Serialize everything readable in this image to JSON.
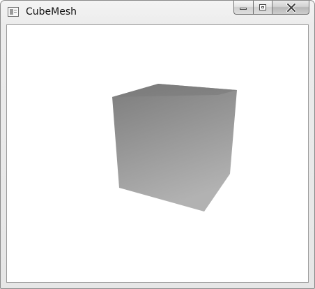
{
  "window": {
    "title": "CubeMesh",
    "icons": {
      "app": "window-app-icon",
      "minimize": "minimize-icon",
      "maximize": "maximize-icon",
      "close": "close-icon"
    }
  },
  "viewport": {
    "background": "#ffffff",
    "object": "gray-shaded-cube",
    "shading": {
      "light": "#b4b4b4",
      "dark": "#7a7a7a"
    }
  }
}
